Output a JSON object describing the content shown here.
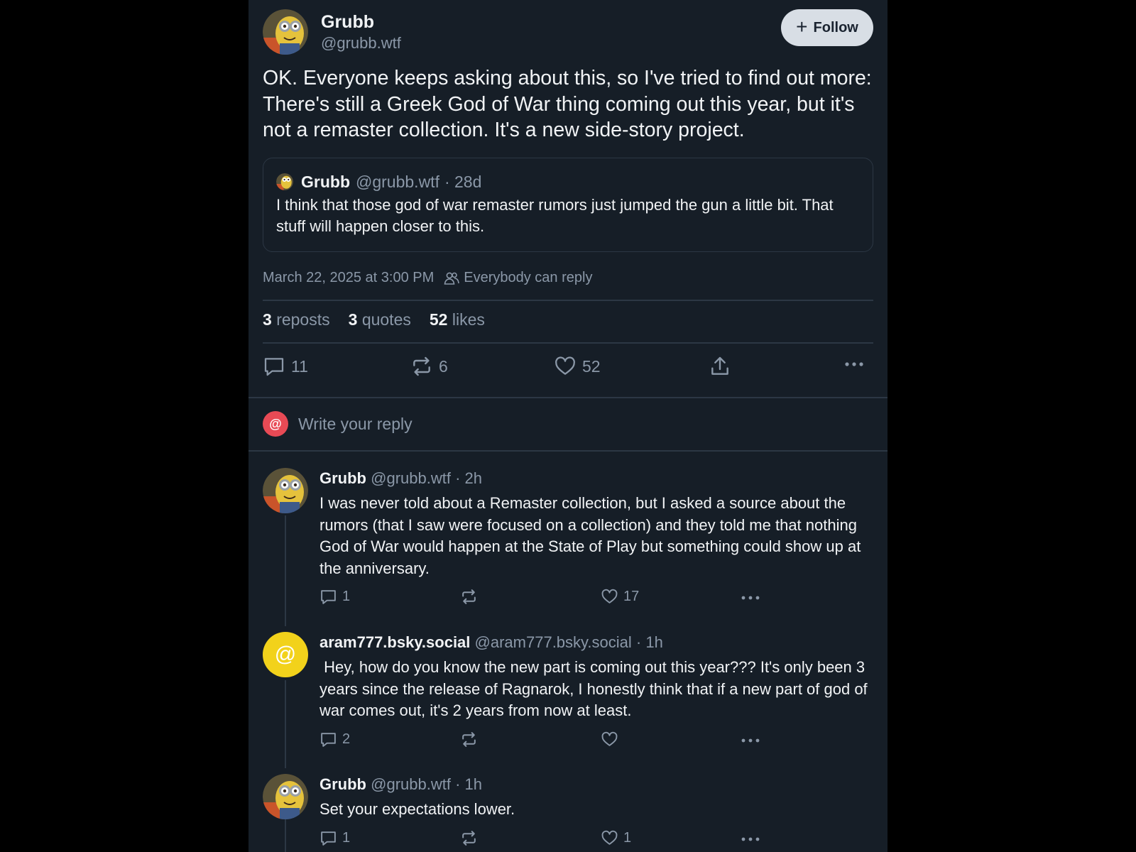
{
  "post": {
    "author_name": "Grubb",
    "author_handle": "@grubb.wtf",
    "follow_label": "Follow",
    "text": "OK. Everyone keeps asking about this, so I've tried to find out more: There's still a Greek God of War thing coming out this year, but it's not a remaster collection. It's a new side-story project.",
    "quote": {
      "name": "Grubb",
      "handle": "@grubb.wtf",
      "age": "· 28d",
      "text": "I think that those god of war remaster rumors just jumped the gun a little bit. That stuff will happen closer to this."
    },
    "timestamp": "March 22, 2025 at 3:00 PM",
    "reply_setting": "Everybody can reply",
    "stats": {
      "reposts_count": "3",
      "reposts_label": "reposts",
      "quotes_count": "3",
      "quotes_label": "quotes",
      "likes_count": "52",
      "likes_label": "likes"
    },
    "actions": {
      "replies": "11",
      "reposts": "6",
      "likes": "52"
    }
  },
  "composer": {
    "avatar_glyph": "@",
    "placeholder": "Write your reply"
  },
  "replies": [
    {
      "name": "Grubb",
      "handle": "@grubb.wtf",
      "age": "· 2h",
      "text": "I was never told about a Remaster collection, but I asked a source about the rumors (that I saw were focused on a collection) and they told me that nothing God of War would happen at the State of Play but something could show up at the anniversary.",
      "replies": "1",
      "reposts": "",
      "likes": "17"
    },
    {
      "name": "aram777.bsky.social",
      "handle": "@aram777.bsky.social",
      "age": "· 1h",
      "avatar_glyph": "@",
      "text": " Hey, how do you know the new part is coming out this year??? It's only been 3 years since the release of Ragnarok, I honestly think that if a new part of god of war comes out, it's 2 years from now at least.",
      "replies": "2",
      "reposts": "",
      "likes": ""
    },
    {
      "name": "Grubb",
      "handle": "@grubb.wtf",
      "age": "· 1h",
      "text": "Set your expectations lower.",
      "replies": "1",
      "reposts": "",
      "likes": "1"
    }
  ],
  "colors": {
    "background": "#161e27",
    "divider": "#2c3744",
    "muted": "#8b98a8",
    "composer_avatar": "#e84a55",
    "aram_avatar": "#f2d21b"
  },
  "icons": [
    "plus-icon",
    "people-icon",
    "comment-icon",
    "repost-icon",
    "heart-icon",
    "share-icon",
    "more-icon"
  ]
}
